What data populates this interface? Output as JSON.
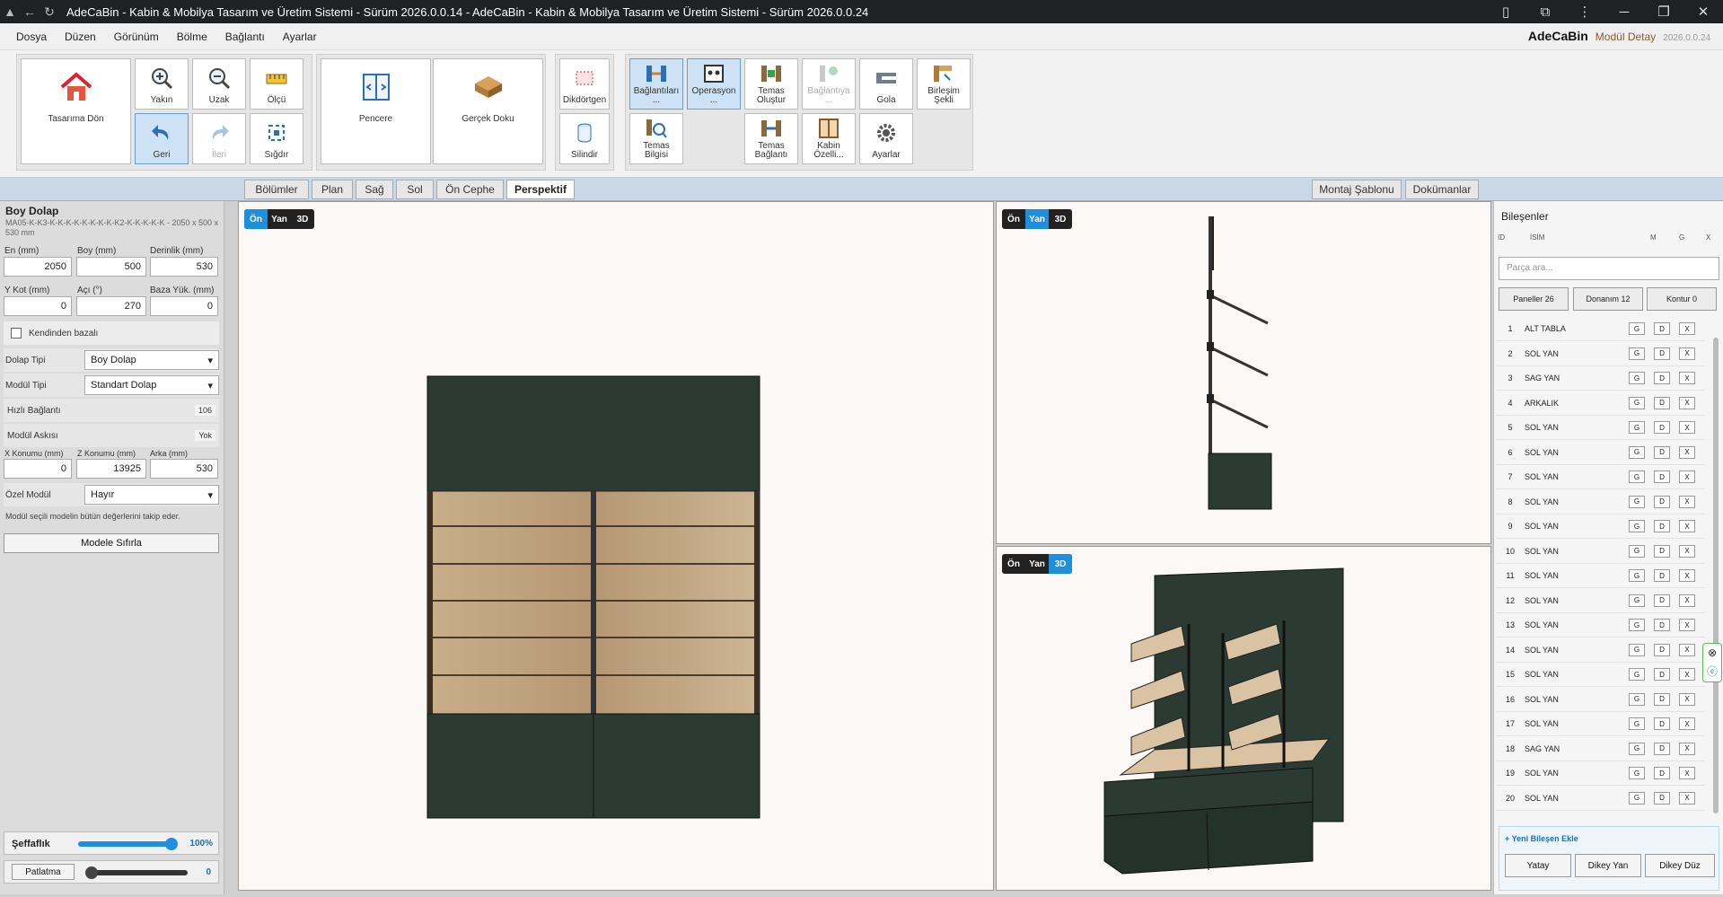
{
  "window": {
    "title": "AdeCaBin - Kabin & Mobilya Tasarım ve Üretim Sistemi - Sürüm 2026.0.0.14 - AdeCaBin - Kabin & Mobilya Tasarım ve Üretim Sistemi - Sürüm 2026.0.0.24"
  },
  "menu": [
    "Dosya",
    "Düzen",
    "Görünüm",
    "Bölme",
    "Bağlantı",
    "Ayarlar"
  ],
  "brand": {
    "name": "AdeCaBin",
    "sub": "Modül Detay",
    "version": "2026.0.0.24"
  },
  "ribbon": {
    "home": "Tasarıma Dön",
    "zoom_in": "Yakın",
    "zoom_out": "Uzak",
    "measure": "Ölçü",
    "back": "Geri",
    "forward": "İleri",
    "fit": "Sığdır",
    "window": "Pencere",
    "texture": "Gerçek Doku",
    "rect": "Dikdörtgen",
    "cylinder": "Silindir",
    "connections": "Bağlantıları ...",
    "operation": "Operasyon ...",
    "contact_create": "Temas Oluştur",
    "link_disabled": "Bağlantıya ...",
    "gola": "Gola",
    "join_shape": "Birleşim Şekli",
    "contact_info": "Temas Bilgisi",
    "contact_link": "Temas Bağlantı",
    "cabin_props": "Kabin Özelli...",
    "settings": "Ayarlar"
  },
  "tabs": {
    "views": [
      "Bölümler",
      "Plan",
      "Sağ",
      "Sol",
      "Ön Cephe",
      "Perspektif"
    ],
    "active": "Perspektif",
    "right": [
      "Montaj Şablonu",
      "Dokümanlar"
    ]
  },
  "module": {
    "title": "Boy Dolap",
    "code": "MA05-K-K3-K-K-K-K-K-K-K-K-K2-K-K-K-K-K - 2050 x 500 x 530 mm",
    "labels": {
      "en": "En (mm)",
      "boy": "Boy (mm)",
      "derinlik": "Derinlik (mm)",
      "ykot": "Y Kot (mm)",
      "aci": "Açı (°)",
      "baza": "Baza Yük. (mm)",
      "self_base": "Kendinden bazalı",
      "cabinet_type": "Dolap Tipi",
      "module_type": "Modül Tipi",
      "quick_conn": "Hızlı Bağlantı",
      "hanger": "Modül Askısı",
      "xpos": "X Konumu (mm)",
      "zpos": "Z Konumu (mm)",
      "back": "Arka (mm)",
      "special": "Özel Modül",
      "note": "Modül seçili modelin bütün değerlerini takip eder.",
      "reset": "Modele Sıfırla"
    },
    "values": {
      "en": "2050",
      "boy": "500",
      "derinlik": "530",
      "ykot": "0",
      "aci": "270",
      "baza": "0",
      "cabinet_type": "Boy Dolap",
      "module_type": "Standart Dolap",
      "quick_conn": "106",
      "hanger": "Yok",
      "xpos": "0",
      "zpos": "13925",
      "back": "530",
      "special": "Hayır"
    }
  },
  "sliders": {
    "transparency_label": "Şeffaflık",
    "transparency_value": "100%",
    "transparency": 1.0,
    "explode_label": "Patlatma",
    "explode_value": "0",
    "explode": 0
  },
  "viewmodes": [
    "Ön",
    "Yan",
    "3D"
  ],
  "components": {
    "title": "Bileşenler",
    "headers": {
      "id": "ID",
      "name": "İSİM",
      "m": "M",
      "g": "G",
      "x": "X"
    },
    "search_placeholder": "Parça ara...",
    "filters": [
      "Paneller 26",
      "Donanım 12",
      "Kontur 0"
    ],
    "rows": [
      {
        "id": "1",
        "name": "ALT TABLA"
      },
      {
        "id": "2",
        "name": "SOL YAN"
      },
      {
        "id": "3",
        "name": "SAG YAN"
      },
      {
        "id": "4",
        "name": "ARKALIK"
      },
      {
        "id": "5",
        "name": "SOL YAN"
      },
      {
        "id": "6",
        "name": "SOL YAN"
      },
      {
        "id": "7",
        "name": "SOL YAN"
      },
      {
        "id": "8",
        "name": "SOL YAN"
      },
      {
        "id": "9",
        "name": "SOL YAN"
      },
      {
        "id": "10",
        "name": "SOL YAN"
      },
      {
        "id": "11",
        "name": "SOL YAN"
      },
      {
        "id": "12",
        "name": "SOL YAN"
      },
      {
        "id": "13",
        "name": "SOL YAN"
      },
      {
        "id": "14",
        "name": "SOL YAN"
      },
      {
        "id": "15",
        "name": "SOL YAN"
      },
      {
        "id": "16",
        "name": "SOL YAN"
      },
      {
        "id": "17",
        "name": "SOL YAN"
      },
      {
        "id": "18",
        "name": "SAG YAN"
      },
      {
        "id": "19",
        "name": "SOL YAN"
      },
      {
        "id": "20",
        "name": "SOL YAN"
      }
    ],
    "row_buttons": [
      "G",
      "D",
      "X"
    ],
    "add_label": "+ Yeni Bileşen Ekle",
    "add_buttons": [
      "Yatay",
      "Dikey Yan",
      "Dikey Düz"
    ]
  },
  "colors": {
    "accent": "#1e8fe0",
    "cabinet": "#2b3a33",
    "wood": "#b79a77"
  }
}
